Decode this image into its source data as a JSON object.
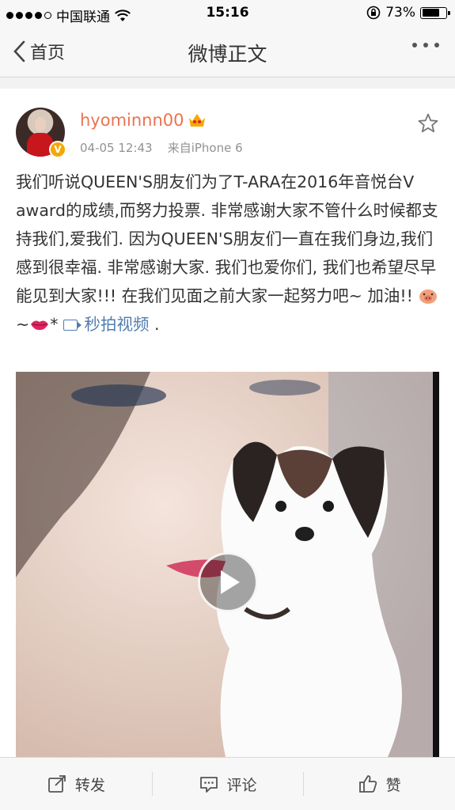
{
  "status_bar": {
    "carrier": "中国联通",
    "time": "15:16",
    "battery": "73%",
    "battery_level": 0.73,
    "signal_bars_filled": 4,
    "signal_bars_total": 5
  },
  "nav": {
    "back_label": "首页",
    "title": "微博正文"
  },
  "post": {
    "username": "hyominnn00",
    "timestamp": "04-05 12:43",
    "source": "来自iPhone 6",
    "text_main": "我们听说QUEEN'S朋友们为了T-ARA在2016年音悦台V award的成绩,而努力投票. 非常感谢大家不管什么时候都支持我们,爱我们. 因为QUEEN'S朋友们一直在我们身边,我们感到很幸福. 非常感谢大家. 我们也爱你们, 我们也希望尽早能见到大家!!! 在我们见面之前大家一起努力吧~ 加油!! ",
    "text_tilde": "~",
    "text_star": "*",
    "video_link": "秒拍视频",
    "text_end": " ."
  },
  "tabs": [
    {
      "label": "转发",
      "icon": "share-icon"
    },
    {
      "label": "评论",
      "icon": "comment-icon"
    },
    {
      "label": "赞",
      "icon": "like-icon"
    }
  ],
  "colors": {
    "username": "#eb7350",
    "link": "#507daf",
    "meta": "#929292"
  }
}
